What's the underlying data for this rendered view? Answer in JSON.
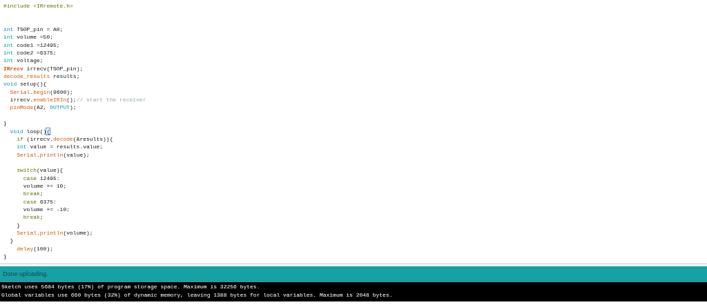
{
  "editor": {
    "lines": [
      {
        "kind": "code",
        "tokens": [
          {
            "kind": "preproc",
            "text": "#include <IRremote.h>"
          }
        ]
      },
      {
        "kind": "blank"
      },
      {
        "kind": "blank"
      },
      {
        "kind": "code",
        "tokens": [
          {
            "kind": "type",
            "text": "int"
          },
          {
            "kind": "plain",
            "text": " TSOP_pin = A0;"
          }
        ]
      },
      {
        "kind": "code",
        "tokens": [
          {
            "kind": "type",
            "text": "int"
          },
          {
            "kind": "plain",
            "text": " volume =50;"
          }
        ]
      },
      {
        "kind": "code",
        "tokens": [
          {
            "kind": "type",
            "text": "int"
          },
          {
            "kind": "plain",
            "text": " code1 =12495;"
          }
        ]
      },
      {
        "kind": "code",
        "tokens": [
          {
            "kind": "type",
            "text": "int"
          },
          {
            "kind": "plain",
            "text": " code2 =6375;"
          }
        ]
      },
      {
        "kind": "code",
        "tokens": [
          {
            "kind": "type",
            "text": "int"
          },
          {
            "kind": "plain",
            "text": " voltage;"
          }
        ]
      },
      {
        "kind": "code",
        "tokens": [
          {
            "kind": "class",
            "text": "IRrecv"
          },
          {
            "kind": "plain",
            "text": " irrecv(TSOP_pin);"
          }
        ]
      },
      {
        "kind": "code",
        "tokens": [
          {
            "kind": "function",
            "text": "decode_results"
          },
          {
            "kind": "plain",
            "text": " results;"
          }
        ]
      },
      {
        "kind": "code",
        "tokens": [
          {
            "kind": "type",
            "text": "void"
          },
          {
            "kind": "plain",
            "text": " setup(){"
          }
        ]
      },
      {
        "kind": "code",
        "tokens": [
          {
            "kind": "function",
            "text": "  Serial"
          },
          {
            "kind": "plain",
            "text": "."
          },
          {
            "kind": "function",
            "text": "begin"
          },
          {
            "kind": "plain",
            "text": "(9600);"
          }
        ]
      },
      {
        "kind": "code",
        "tokens": [
          {
            "kind": "plain",
            "text": "  irrecv."
          },
          {
            "kind": "function",
            "text": "enableIRIn"
          },
          {
            "kind": "plain",
            "text": "();"
          },
          {
            "kind": "comment",
            "text": "// start the receiver"
          }
        ]
      },
      {
        "kind": "code",
        "tokens": [
          {
            "kind": "function",
            "text": "  pinMode"
          },
          {
            "kind": "plain",
            "text": "(A2, "
          },
          {
            "kind": "constant",
            "text": "OUTPUT"
          },
          {
            "kind": "plain",
            "text": ");"
          }
        ]
      },
      {
        "kind": "blank"
      },
      {
        "kind": "code",
        "tokens": [
          {
            "kind": "plain",
            "text": "}"
          }
        ]
      },
      {
        "kind": "code",
        "tokens": [
          {
            "kind": "type",
            "text": "  void"
          },
          {
            "kind": "plain",
            "text": " loop()"
          },
          {
            "kind": "matched",
            "text": "{"
          }
        ]
      },
      {
        "kind": "code",
        "tokens": [
          {
            "kind": "keyword",
            "text": "    if"
          },
          {
            "kind": "plain",
            "text": " (irrecv."
          },
          {
            "kind": "function",
            "text": "decode"
          },
          {
            "kind": "plain",
            "text": "(&results)){"
          }
        ]
      },
      {
        "kind": "code",
        "tokens": [
          {
            "kind": "type",
            "text": "    int"
          },
          {
            "kind": "plain",
            "text": " value = results.value;"
          }
        ]
      },
      {
        "kind": "code",
        "tokens": [
          {
            "kind": "function",
            "text": "    Serial"
          },
          {
            "kind": "plain",
            "text": "."
          },
          {
            "kind": "function",
            "text": "println"
          },
          {
            "kind": "plain",
            "text": "(value);"
          }
        ]
      },
      {
        "kind": "blank"
      },
      {
        "kind": "code",
        "tokens": [
          {
            "kind": "keyword",
            "text": "    switch"
          },
          {
            "kind": "plain",
            "text": "(value){"
          }
        ]
      },
      {
        "kind": "code",
        "tokens": [
          {
            "kind": "keyword",
            "text": "      case"
          },
          {
            "kind": "plain",
            "text": " 12495:"
          }
        ]
      },
      {
        "kind": "code",
        "tokens": [
          {
            "kind": "plain",
            "text": "      volume += 10;"
          }
        ]
      },
      {
        "kind": "code",
        "tokens": [
          {
            "kind": "keyword",
            "text": "      break"
          },
          {
            "kind": "plain",
            "text": ";"
          }
        ]
      },
      {
        "kind": "code",
        "tokens": [
          {
            "kind": "keyword",
            "text": "      case"
          },
          {
            "kind": "plain",
            "text": " 6375:"
          }
        ]
      },
      {
        "kind": "code",
        "tokens": [
          {
            "kind": "plain",
            "text": "      volume += -10;"
          }
        ]
      },
      {
        "kind": "code",
        "tokens": [
          {
            "kind": "keyword",
            "text": "      break"
          },
          {
            "kind": "plain",
            "text": ";"
          }
        ]
      },
      {
        "kind": "code",
        "tokens": [
          {
            "kind": "plain",
            "text": "    }"
          }
        ]
      },
      {
        "kind": "code",
        "tokens": [
          {
            "kind": "function",
            "text": "    Serial"
          },
          {
            "kind": "plain",
            "text": "."
          },
          {
            "kind": "function",
            "text": "println"
          },
          {
            "kind": "plain",
            "text": "(volume);"
          }
        ]
      },
      {
        "kind": "code",
        "tokens": [
          {
            "kind": "plain",
            "text": "  }"
          }
        ]
      },
      {
        "kind": "code",
        "tokens": [
          {
            "kind": "function",
            "text": "    delay"
          },
          {
            "kind": "plain",
            "text": "(100);"
          }
        ]
      },
      {
        "kind": "code",
        "tokens": [
          {
            "kind": "plain",
            "text": "}"
          }
        ]
      }
    ]
  },
  "status_bar": {
    "message": "Done uploading."
  },
  "console": {
    "lines": [
      "Sketch uses 5684 bytes (17%) of program storage space. Maximum is 32256 bytes.",
      "Global variables use 660 bytes (32%) of dynamic memory, leaving 1388 bytes for local variables. Maximum is 2048 bytes."
    ]
  }
}
